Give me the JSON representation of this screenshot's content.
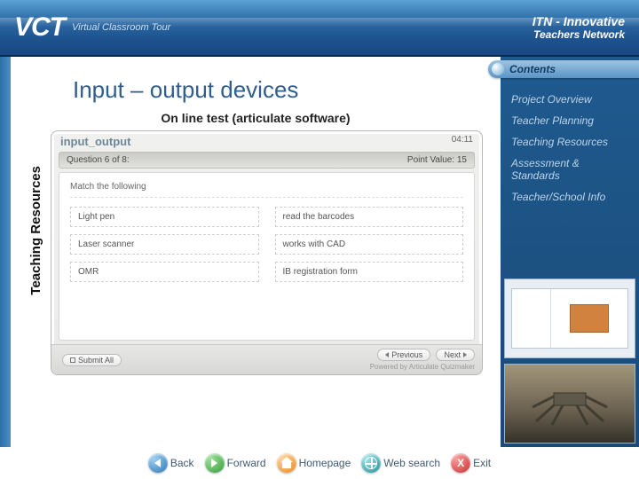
{
  "banner": {
    "vct_mark": "VCT",
    "vct_sub": "Virtual Classroom Tour",
    "itn_line1": "ITN - Innovative",
    "itn_line2": "Teachers Network"
  },
  "page": {
    "title": "Input – output devices",
    "subtitle": "On line test (articulate software)",
    "side_label": "Teaching Resources"
  },
  "sidebar": {
    "tab": "Contents",
    "links": [
      "Project Overview",
      "Teacher Planning",
      "Teaching Resources",
      "Assessment & Standards",
      "Teacher/School Info"
    ]
  },
  "quiz": {
    "header_title": "input_output",
    "header_time": "04:11",
    "question_label": "Question 6 of 8:",
    "points_label": "Point Value: 15",
    "instruction": "Match the following",
    "pairs": [
      {
        "left": "Light pen",
        "right": "read the barcodes"
      },
      {
        "left": "Laser scanner",
        "right": "works with CAD"
      },
      {
        "left": "OMR",
        "right": "IB registration form"
      }
    ],
    "submit_label": "Submit All",
    "prev_label": "Previous",
    "next_label": "Next",
    "powered": "Powered by Articulate Quizmaker"
  },
  "nav": {
    "back": "Back",
    "forward": "Forward",
    "home": "Homepage",
    "search": "Web search",
    "exit": "Exit"
  }
}
